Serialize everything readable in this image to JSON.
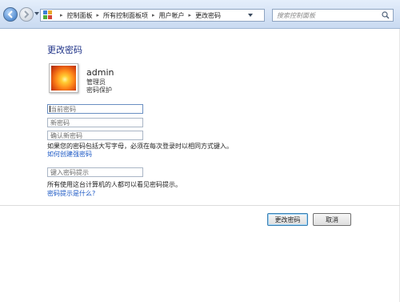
{
  "nav": {
    "breadcrumbs": [
      "控制面板",
      "所有控制面板项",
      "用户帐户",
      "更改密码"
    ],
    "search_placeholder": "搜索控制面板"
  },
  "page": {
    "title": "更改密码",
    "user": {
      "name": "admin",
      "role": "管理员",
      "protection": "密码保护"
    },
    "fields": {
      "current_password": "当前密码",
      "new_password": "新密码",
      "confirm_password": "确认新密码",
      "password_hint": "键入密码提示"
    },
    "uppercase_note": "如果您的密码包括大写字母，必须在每次登录时以相同方式键入。",
    "strong_password_link": "如何创建强密码",
    "hint_note": "所有使用这台计算机的人都可以看见密码提示。",
    "hint_link": "密码提示是什么?"
  },
  "buttons": {
    "change_password": "更改密码",
    "cancel": "取消"
  },
  "colors": {
    "title": "#1e3287",
    "link": "#1a57c4",
    "nav_gradient_top": "#e4eefb",
    "nav_gradient_bottom": "#c9daf1"
  }
}
